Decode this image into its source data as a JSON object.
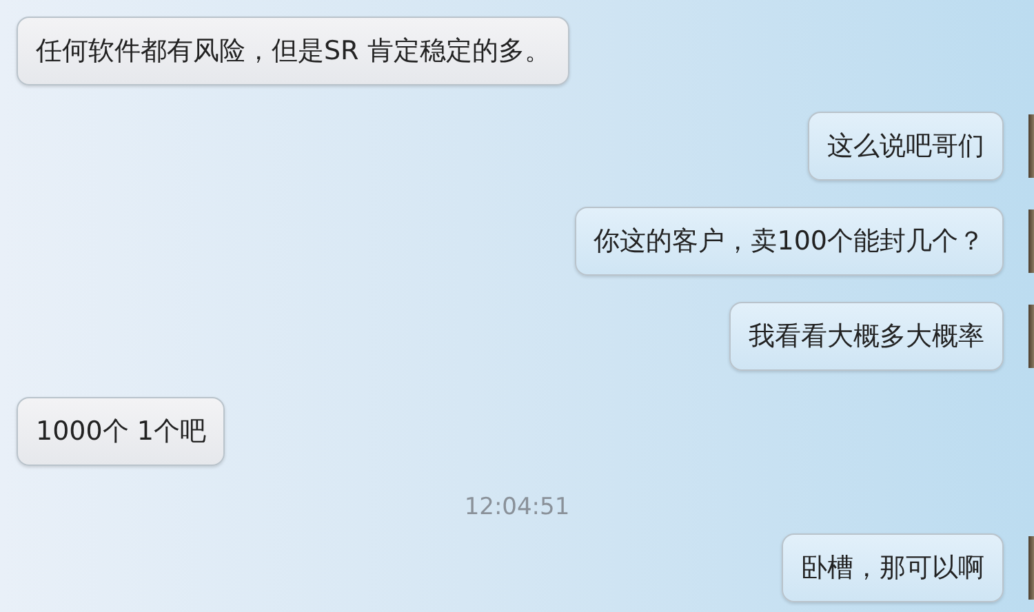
{
  "messages": [
    {
      "kind": "incoming",
      "text": "任何软件都有风险，但是SR 肯定稳定的多。"
    },
    {
      "kind": "outgoing",
      "text": "这么说吧哥们"
    },
    {
      "kind": "outgoing",
      "text": "你这的客户，卖100个能封几个？"
    },
    {
      "kind": "outgoing",
      "text": "我看看大概多大概率"
    },
    {
      "kind": "incoming",
      "text": "1000个 1个吧"
    },
    {
      "kind": "timestamp",
      "text": "12:04:51"
    },
    {
      "kind": "outgoing",
      "text": "卧槽，那可以啊"
    }
  ]
}
